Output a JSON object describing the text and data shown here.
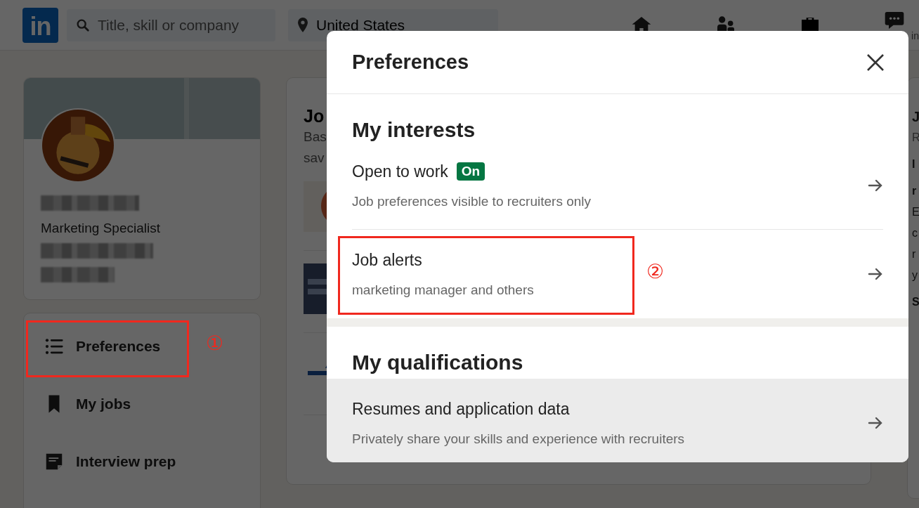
{
  "header": {
    "logo": "in",
    "search": {
      "placeholder": "Title, skill or company"
    },
    "location": {
      "value": "United States"
    },
    "nav_label": "in"
  },
  "profile": {
    "headline": "Marketing Specialist"
  },
  "sidebar": {
    "items": [
      {
        "label": "Preferences"
      },
      {
        "label": "My jobs"
      },
      {
        "label": "Interview prep"
      }
    ]
  },
  "jobs_card": {
    "title": "Jo",
    "subtitle_lines": [
      "Bas",
      "sav"
    ],
    "logos": [
      {
        "kind": "picture"
      },
      {
        "kind": "picture"
      },
      {
        "kind": "picture"
      }
    ]
  },
  "right_card": {
    "lines": [
      {
        "text": "J",
        "kind": "title"
      },
      {
        "text": "R",
        "kind": "sub"
      },
      {
        "text": "I",
        "kind": "bold"
      },
      {
        "text": "r",
        "kind": "bold"
      },
      {
        "text": "E",
        "kind": "body"
      },
      {
        "text": "c",
        "kind": "body"
      },
      {
        "text": "r",
        "kind": "body"
      },
      {
        "text": "y",
        "kind": "body"
      },
      {
        "text": "S",
        "kind": "bold"
      }
    ]
  },
  "modal": {
    "title": "Preferences",
    "sections": [
      {
        "heading": "My interests",
        "items": [
          {
            "title": "Open to work",
            "badge": "On",
            "subtitle": "Job preferences visible to recruiters only",
            "highlighted": false
          },
          {
            "title": "Job alerts",
            "subtitle": "marketing manager and others",
            "highlighted": false
          }
        ]
      },
      {
        "heading": "My qualifications",
        "items": [
          {
            "title": "Resumes and application data",
            "subtitle": "Privately share your skills and experience with recruiters",
            "highlighted": true
          }
        ]
      }
    ]
  },
  "annotations": [
    {
      "label": "①"
    },
    {
      "label": "②"
    }
  ]
}
